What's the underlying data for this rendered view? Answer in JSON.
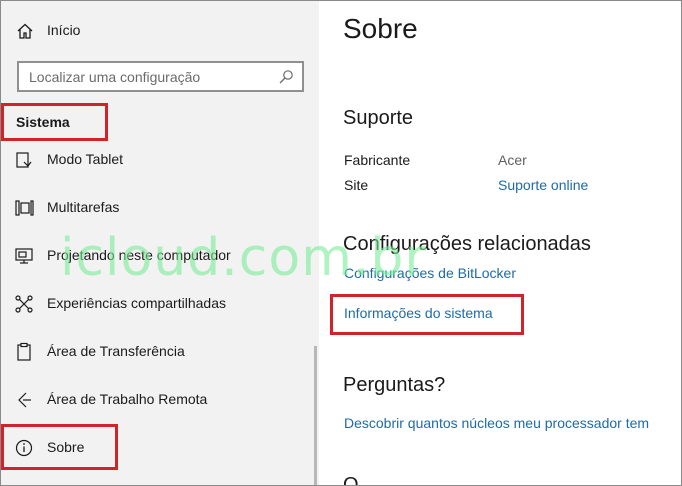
{
  "sidebar": {
    "home_label": "Início",
    "search_placeholder": "Localizar uma configuração",
    "section_title": "Sistema",
    "items": [
      {
        "label": "Modo Tablet",
        "icon": "tablet-mode-icon"
      },
      {
        "label": "Multitarefas",
        "icon": "multitasking-icon"
      },
      {
        "label": "Projetando neste computador",
        "icon": "projecting-icon"
      },
      {
        "label": "Experiências compartilhadas",
        "icon": "shared-experiences-icon"
      },
      {
        "label": "Área de Transferência",
        "icon": "clipboard-icon"
      },
      {
        "label": "Área de Trabalho Remota",
        "icon": "remote-desktop-icon"
      },
      {
        "label": "Sobre",
        "icon": "info-icon"
      }
    ]
  },
  "main": {
    "title": "Sobre",
    "support": {
      "heading": "Suporte",
      "manufacturer_label": "Fabricante",
      "manufacturer_value": "Acer",
      "site_label": "Site",
      "site_link": "Suporte online"
    },
    "related": {
      "heading": "Configurações relacionadas",
      "links": [
        "Configurações de BitLocker",
        "Informações do sistema"
      ]
    },
    "questions": {
      "heading": "Perguntas?",
      "link": "Descobrir quantos núcleos meu processador tem"
    },
    "partial_heading": "Q"
  },
  "watermark": "icloud.com.br",
  "colors": {
    "sidebar_bg": "#f2f2f2",
    "link": "#1e6ba8",
    "highlight": "#d2232a",
    "watermark": "#78eb96"
  }
}
